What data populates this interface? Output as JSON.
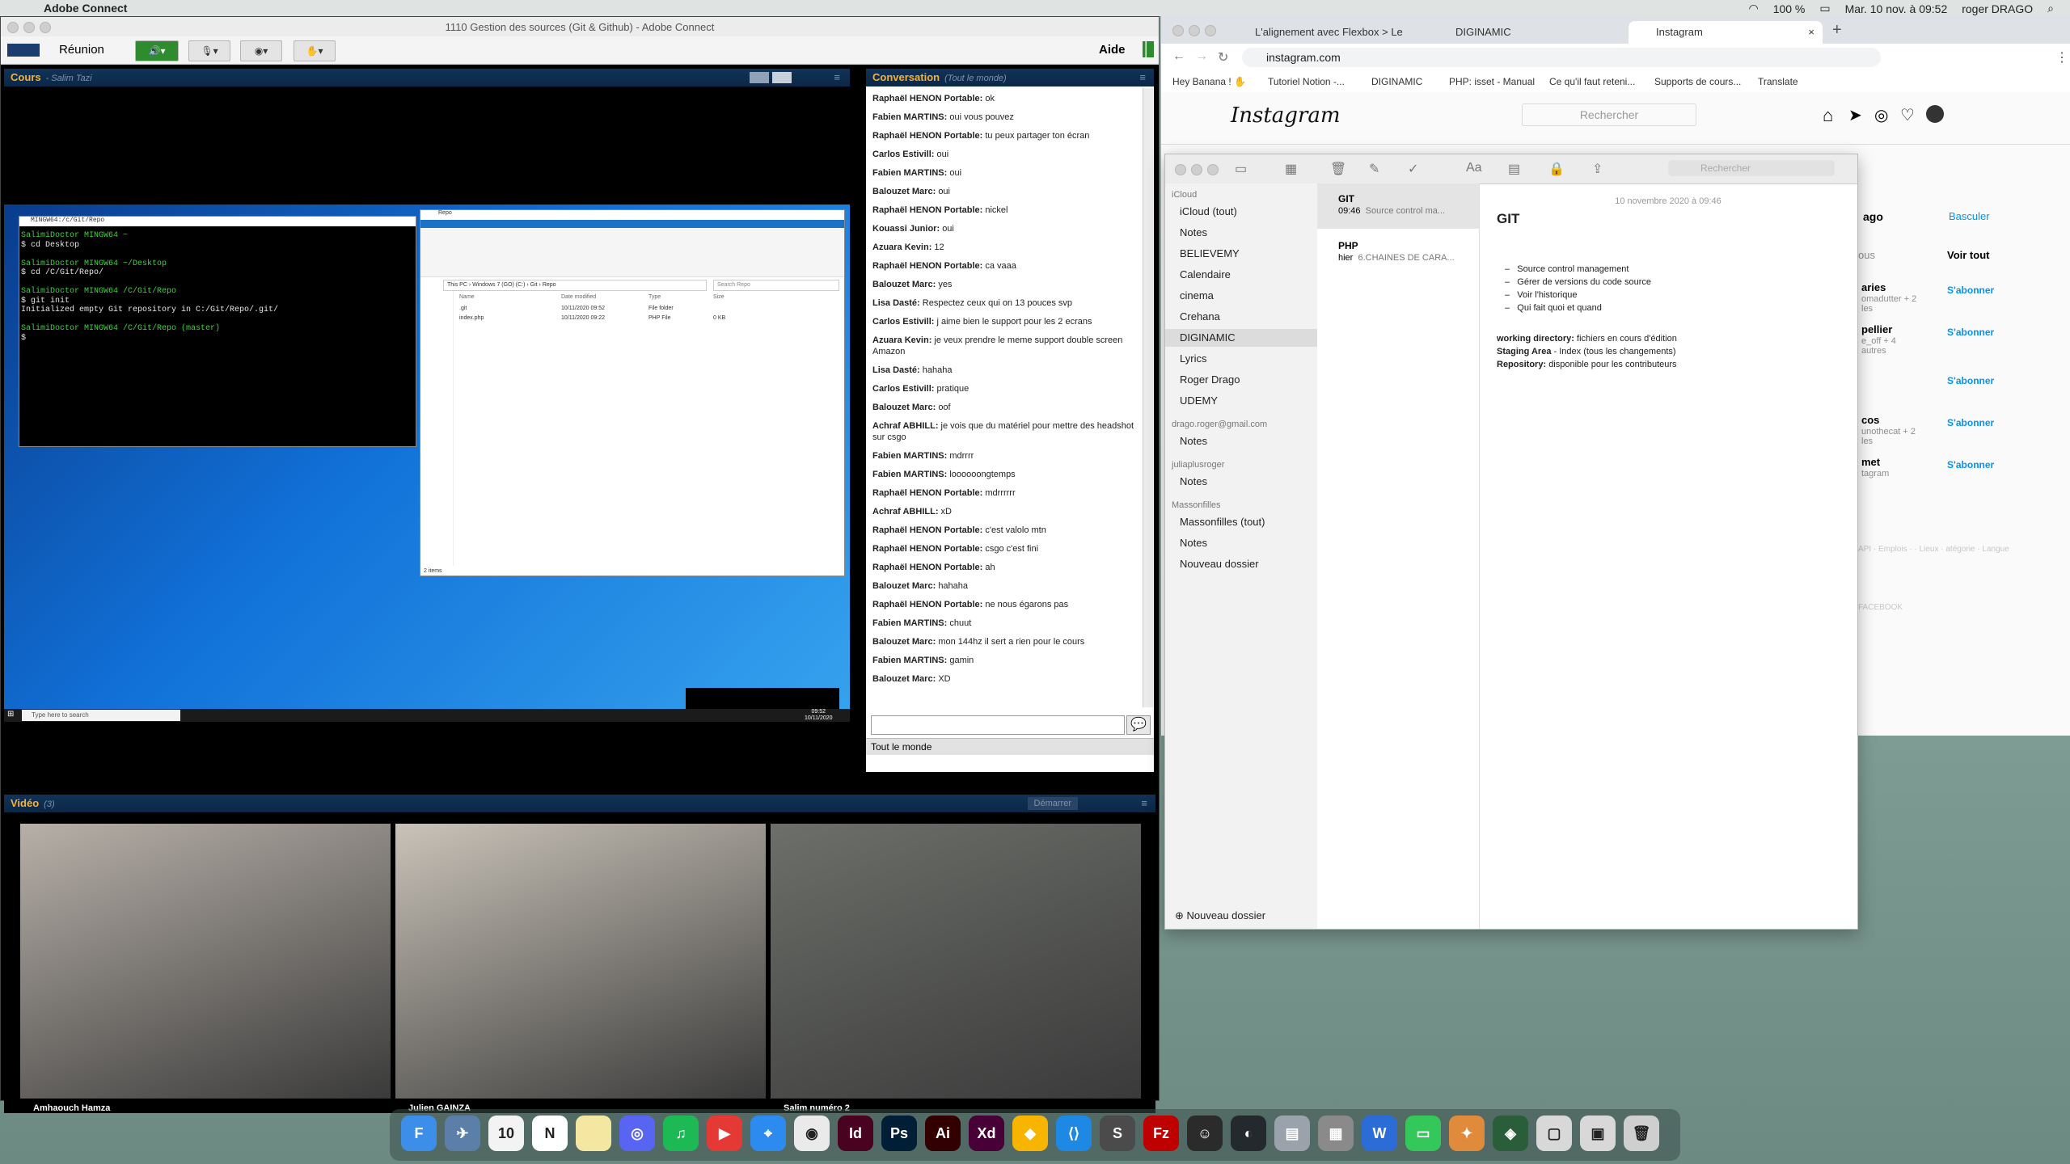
{
  "menubar": {
    "app_name": "Adobe Connect",
    "status_right": "100 %",
    "datetime": "Mar. 10 nov. à 09:52",
    "user": "roger DRAGO"
  },
  "adobe": {
    "window_title": "1110 Gestion des sources (Git & Github) - Adobe Connect",
    "menu_reunion": "Réunion",
    "menu_aide": "Aide",
    "cours_title": "Cours",
    "cours_sub": "- Salim Tazi",
    "conv_title": "Conversation",
    "conv_sub": "(Tout le monde)",
    "conv_footer_tab": "Tout le monde",
    "video_title": "Vidéo",
    "video_count": "(3)",
    "video_start": "Démarrer"
  },
  "terminal": {
    "title": "MINGW64:/c/Git/Repo",
    "lines": [
      {
        "prompt": "SalimiDoctor MINGW64 ~",
        "cmd": "$ cd Desktop"
      },
      {
        "prompt": "SalimiDoctor MINGW64 ~/Desktop",
        "cmd": "$ cd /C/Git/Repo/"
      },
      {
        "prompt": "SalimiDoctor MINGW64 /C/Git/Repo",
        "cmd": "$ git init"
      }
    ],
    "init_msg": "Initialized empty Git repository in C:/Git/Repo/.git/",
    "last_prompt": "SalimiDoctor MINGW64 /C/Git/Repo (master)",
    "last_cmd": "$"
  },
  "explorer": {
    "title": "Repo",
    "path": "This PC › Windows 7 (GO) (C:) › Git › Repo",
    "search": "Search Repo",
    "col_name": "Name",
    "col_date": "Date modified",
    "col_type": "Type",
    "col_size": "Size",
    "rows": [
      {
        "name": ".git",
        "date": "10/11/2020 09:52",
        "type": "File folder",
        "size": ""
      },
      {
        "name": "index.php",
        "date": "10/11/2020 09:22",
        "type": "PHP File",
        "size": "0 KB"
      }
    ],
    "items_count": "2 items"
  },
  "win_taskbar": {
    "search": "Type here to search",
    "time": "09:52",
    "date": "10/11/2020"
  },
  "conversation": [
    {
      "who": "Raphaël HENON Portable:",
      "text": "ok"
    },
    {
      "who": "Fabien MARTINS:",
      "text": "oui vous pouvez"
    },
    {
      "who": "Raphaël HENON Portable:",
      "text": "tu peux partager ton écran"
    },
    {
      "who": "Carlos Estivill:",
      "text": "oui"
    },
    {
      "who": "Fabien MARTINS:",
      "text": "oui"
    },
    {
      "who": "Balouzet Marc:",
      "text": "oui"
    },
    {
      "who": "Raphaël HENON Portable:",
      "text": "nickel"
    },
    {
      "who": "Kouassi Junior:",
      "text": "oui"
    },
    {
      "who": "Azuara Kevin:",
      "text": "12"
    },
    {
      "who": "Raphaël HENON Portable:",
      "text": "ca vaaa"
    },
    {
      "who": "Balouzet Marc:",
      "text": "yes"
    },
    {
      "who": "Lisa Dasté:",
      "text": "Respectez ceux qui on 13 pouces svp"
    },
    {
      "who": "Carlos Estivill:",
      "text": "j aime bien le support pour les 2 ecrans"
    },
    {
      "who": "Azuara Kevin:",
      "text": "je veux prendre le meme support double screen Amazon"
    },
    {
      "who": "Lisa Dasté:",
      "text": "hahaha"
    },
    {
      "who": "Carlos Estivill:",
      "text": "pratique"
    },
    {
      "who": "Balouzet Marc:",
      "text": "oof"
    },
    {
      "who": "Achraf ABHILL:",
      "text": "je vois que du matériel pour mettre des headshot sur csgo"
    },
    {
      "who": "Fabien MARTINS:",
      "text": "mdrrrr"
    },
    {
      "who": "Fabien MARTINS:",
      "text": "loooooongtemps"
    },
    {
      "who": "Raphaël HENON Portable:",
      "text": "mdrrrrrr"
    },
    {
      "who": "Achraf ABHILL:",
      "text": "xD"
    },
    {
      "who": "Raphaël HENON Portable:",
      "text": "c'est valolo mtn"
    },
    {
      "who": "Raphaël HENON Portable:",
      "text": "csgo c'est fini"
    },
    {
      "who": "Raphaël HENON Portable:",
      "text": "ah"
    },
    {
      "who": "Balouzet Marc:",
      "text": "hahaha"
    },
    {
      "who": "Raphaël HENON Portable:",
      "text": "ne nous égarons pas"
    },
    {
      "who": "Fabien MARTINS:",
      "text": "chuut"
    },
    {
      "who": "Balouzet Marc:",
      "text": "mon 144hz il sert a rien pour le cours"
    },
    {
      "who": "Fabien MARTINS:",
      "text": "gamin"
    },
    {
      "who": "Balouzet Marc:",
      "text": "XD"
    }
  ],
  "video_feeds": [
    {
      "name": "Amhaouch Hamza",
      "color": "#b7b0a8"
    },
    {
      "name": "Julien GAINZA",
      "color": "#c9c3b8"
    },
    {
      "name": "Salim numéro 2",
      "color": "#6c6f6a"
    }
  ],
  "chrome": {
    "tabs": [
      {
        "label": "L'alignement avec Flexbox > Le"
      },
      {
        "label": "DIGINAMIC"
      },
      {
        "label": "Instagram"
      }
    ],
    "url": "instagram.com",
    "bookmarks": [
      "Hey Banana ! ✋",
      "Tutoriel Notion -...",
      "DIGINAMIC",
      "PHP: isset - Manual",
      "Ce qu'il faut reteni...",
      "Supports de cours...",
      "Translate"
    ]
  },
  "instagram": {
    "logo": "Instagram",
    "search": "Rechercher",
    "side_frag_1": "ago",
    "switch": "Basculer",
    "frag_vous": "ous",
    "see_all": "Voir tout",
    "follow": "S'abonner",
    "suggestions": [
      {
        "name": "aries",
        "sub": "omadutter + 2 les"
      },
      {
        "name": "pellier",
        "sub": "e_off + 4 autres"
      },
      {
        "name": "",
        "sub": ""
      },
      {
        "name": "cos",
        "sub": "unothecat + 2 les"
      },
      {
        "name": "met",
        "sub": "tagram"
      }
    ],
    "footer": "API · Emplois · · Lieux · atégorie · Langue",
    "footer2": "FACEBOOK"
  },
  "notes": {
    "search": "Rechercher",
    "groups": [
      {
        "title": "iCloud",
        "items": [
          "iCloud (tout)",
          "Notes",
          "BELIEVEMY",
          "Calendaire",
          "cinema",
          "Crehana",
          "DIGINAMIC",
          "Lyrics",
          "Roger Drago",
          "UDEMY"
        ]
      },
      {
        "title": "drago.roger@gmail.com",
        "items": [
          "Notes"
        ]
      },
      {
        "title": "juliaplusroger",
        "items": [
          "Notes"
        ]
      },
      {
        "title": "Massonfilles",
        "items": [
          "Massonfilles (tout)",
          "Notes",
          "Nouveau dossier"
        ]
      }
    ],
    "new_folder": "Nouveau dossier",
    "list": [
      {
        "title": "GIT",
        "time": "09:46",
        "preview": "Source control ma..."
      },
      {
        "title": "PHP",
        "time": "hier",
        "preview": "6.CHAINES DE CARA..."
      }
    ],
    "note_date": "10 novembre 2020 à 09:46",
    "note_title": "GIT",
    "bullets": [
      "Source control management",
      "Gérer de versions du code source",
      "Voir l'historique",
      "Qui fait quoi et quand"
    ],
    "defs": [
      {
        "term": "working directory:",
        "desc": "fichiers en cours d'édition"
      },
      {
        "term": "Staging Area",
        "desc": "- Index (tous les changements)"
      },
      {
        "term": "Repository:",
        "desc": "disponible pour les contributeurs"
      }
    ]
  },
  "dock": [
    {
      "label": "F",
      "color": "#3d8ee8"
    },
    {
      "label": "✈",
      "color": "#5b7fa8"
    },
    {
      "label": "10",
      "color": "#f3f3f3"
    },
    {
      "label": "N",
      "color": "#ffffff"
    },
    {
      "label": "",
      "color": "#f4e7a2"
    },
    {
      "label": "◎",
      "color": "#5865f2"
    },
    {
      "label": "♫",
      "color": "#1db954"
    },
    {
      "label": "▶",
      "color": "#e53935"
    },
    {
      "label": "⌖",
      "color": "#2d8bf0"
    },
    {
      "label": "◉",
      "color": "#eaeaea"
    },
    {
      "label": "Id",
      "color": "#49021f"
    },
    {
      "label": "Ps",
      "color": "#001e36"
    },
    {
      "label": "Ai",
      "color": "#330000"
    },
    {
      "label": "Xd",
      "color": "#470137"
    },
    {
      "label": "◆",
      "color": "#f7b500"
    },
    {
      "label": "⟨⟩",
      "color": "#1e88e5"
    },
    {
      "label": "S",
      "color": "#4b4b4b"
    },
    {
      "label": "Fz",
      "color": "#bf0000"
    },
    {
      "label": "☺",
      "color": "#2b2b2b"
    },
    {
      "label": "◐",
      "color": "#24292e"
    },
    {
      "label": "▤",
      "color": "#9aa3ab"
    },
    {
      "label": "▦",
      "color": "#8a8a8a"
    },
    {
      "label": "W",
      "color": "#2b6cd6"
    },
    {
      "label": "▭",
      "color": "#34c759"
    },
    {
      "label": "✦",
      "color": "#e08a3c"
    },
    {
      "label": "◈",
      "color": "#2a5d3a"
    },
    {
      "label": "▢",
      "color": "#d8d8d8"
    },
    {
      "label": "▣",
      "color": "#d8d8d8"
    },
    {
      "label": "🗑",
      "color": "#cfcfcf"
    }
  ]
}
